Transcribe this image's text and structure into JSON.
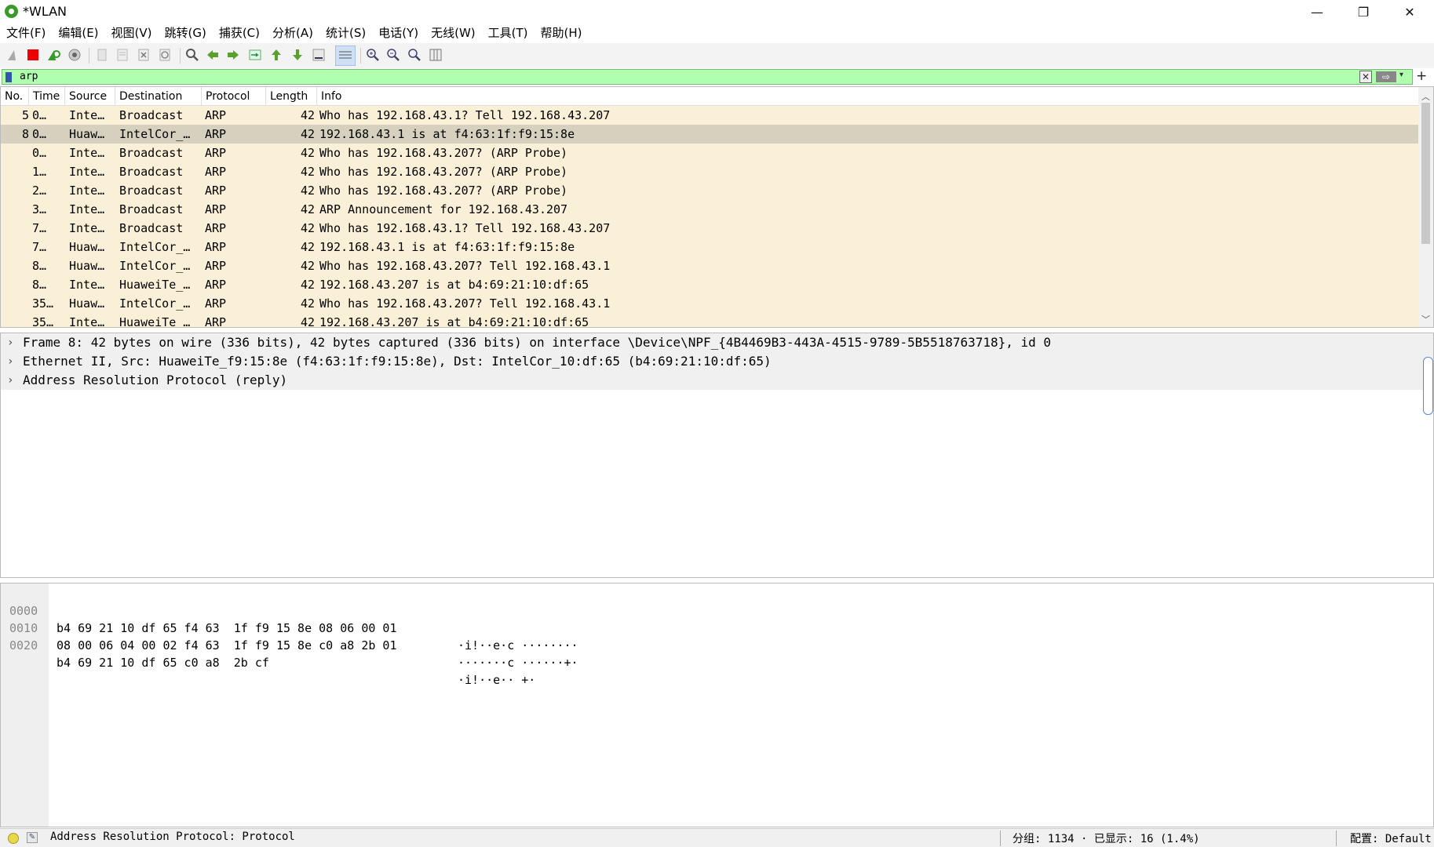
{
  "window": {
    "title": "*WLAN",
    "minimize": "—",
    "maximize": "❐",
    "close": "✕"
  },
  "menu": [
    "文件(F)",
    "编辑(E)",
    "视图(V)",
    "跳转(G)",
    "捕获(C)",
    "分析(A)",
    "统计(S)",
    "电话(Y)",
    "无线(W)",
    "工具(T)",
    "帮助(H)"
  ],
  "filter": {
    "value": "arp",
    "clear": "✕",
    "apply": "⇨",
    "dropdown": "▾",
    "add": "+"
  },
  "packet_list": {
    "columns": [
      "No.",
      "Time",
      "Source",
      "Destination",
      "Protocol",
      "Length",
      "Info"
    ],
    "rows": [
      {
        "no": "5",
        "time": "0…",
        "source": "Inte…",
        "destination": "Broadcast",
        "protocol": "ARP",
        "length": "42",
        "info": "Who has 192.168.43.1? Tell 192.168.43.207"
      },
      {
        "no": "8",
        "time": "0…",
        "source": "Huaw…",
        "destination": "IntelCor_…",
        "protocol": "ARP",
        "length": "42",
        "info": "192.168.43.1 is at f4:63:1f:f9:15:8e"
      },
      {
        "no": "",
        "time": "0…",
        "source": "Inte…",
        "destination": "Broadcast",
        "protocol": "ARP",
        "length": "42",
        "info": "Who has 192.168.43.207? (ARP Probe)"
      },
      {
        "no": "",
        "time": "1…",
        "source": "Inte…",
        "destination": "Broadcast",
        "protocol": "ARP",
        "length": "42",
        "info": "Who has 192.168.43.207? (ARP Probe)"
      },
      {
        "no": "",
        "time": "2…",
        "source": "Inte…",
        "destination": "Broadcast",
        "protocol": "ARP",
        "length": "42",
        "info": "Who has 192.168.43.207? (ARP Probe)"
      },
      {
        "no": "",
        "time": "3…",
        "source": "Inte…",
        "destination": "Broadcast",
        "protocol": "ARP",
        "length": "42",
        "info": "ARP Announcement for 192.168.43.207"
      },
      {
        "no": "",
        "time": "7…",
        "source": "Inte…",
        "destination": "Broadcast",
        "protocol": "ARP",
        "length": "42",
        "info": "Who has 192.168.43.1? Tell 192.168.43.207"
      },
      {
        "no": "",
        "time": "7…",
        "source": "Huaw…",
        "destination": "IntelCor_…",
        "protocol": "ARP",
        "length": "42",
        "info": "192.168.43.1 is at f4:63:1f:f9:15:8e"
      },
      {
        "no": "",
        "time": "8…",
        "source": "Huaw…",
        "destination": "IntelCor_…",
        "protocol": "ARP",
        "length": "42",
        "info": "Who has 192.168.43.207? Tell 192.168.43.1"
      },
      {
        "no": "",
        "time": "8…",
        "source": "Inte…",
        "destination": "HuaweiTe_…",
        "protocol": "ARP",
        "length": "42",
        "info": "192.168.43.207 is at b4:69:21:10:df:65"
      },
      {
        "no": "",
        "time": "35…",
        "source": "Huaw…",
        "destination": "IntelCor_…",
        "protocol": "ARP",
        "length": "42",
        "info": "Who has 192.168.43.207? Tell 192.168.43.1"
      },
      {
        "no": "",
        "time": "35…",
        "source": "Inte…",
        "destination": "HuaweiTe_…",
        "protocol": "ARP",
        "length": "42",
        "info": "192.168.43.207 is at b4:69:21:10:df:65"
      }
    ],
    "selected_index": 1,
    "scroll_up": "︿",
    "scroll_down": "﹀"
  },
  "details": {
    "rows": [
      "Frame 8: 42 bytes on wire (336 bits), 42 bytes captured (336 bits) on interface \\Device\\NPF_{4B4469B3-443A-4515-9789-5B5518763718}, id 0",
      "Ethernet II, Src: HuaweiTe_f9:15:8e (f4:63:1f:f9:15:8e), Dst: IntelCor_10:df:65 (b4:69:21:10:df:65)",
      "Address Resolution Protocol (reply)"
    ],
    "chevron": "›"
  },
  "bytes": {
    "lines": [
      {
        "offset": "0000",
        "hex": "b4 69 21 10 df 65 f4 63  1f f9 15 8e 08 06 00 01",
        "ascii": "·i!··e·c ········"
      },
      {
        "offset": "0010",
        "hex": "08 00 06 04 00 02 f4 63  1f f9 15 8e c0 a8 2b 01",
        "ascii": "·······c ······+·"
      },
      {
        "offset": "0020",
        "hex": "b4 69 21 10 df 65 c0 a8  2b cf",
        "ascii": "·i!··e·· +·"
      }
    ]
  },
  "status": {
    "text": "Address Resolution Protocol: Protocol",
    "packets": "分组: 1134 · 已显示: 16 (1.4%)",
    "profile": "配置: Default"
  },
  "colors": {
    "row_background": "#faf0d7",
    "row_selected": "#d6d0be",
    "filter_valid": "#afffaf"
  }
}
